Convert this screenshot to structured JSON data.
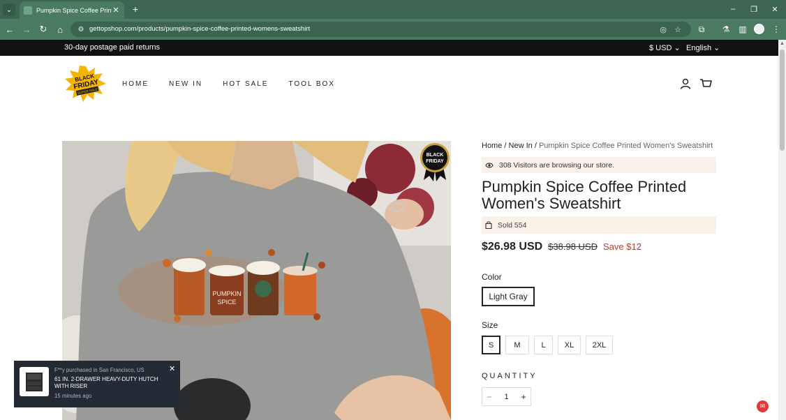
{
  "browser": {
    "tab_title": "Pumpkin Spice Coffee Printed Women",
    "url": "gettopshop.com/products/pumpkin-spice-coffee-printed-womens-sweatshirt"
  },
  "announcement": {
    "text": "30-day postage paid returns",
    "currency": "$ USD",
    "language": "English"
  },
  "header": {
    "logo_text": [
      "BLACK",
      "FRIDAY",
      "SUPER SALE"
    ],
    "nav": [
      "HOME",
      "NEW IN",
      "HOT SALE",
      "TOOL BOX"
    ]
  },
  "badge": {
    "lines": [
      "BLACK",
      "FRIDAY"
    ]
  },
  "breadcrumb": {
    "home": "Home",
    "sep1": " / ",
    "section": "New In",
    "sep2": " / ",
    "current": "Pumpkin Spice Coffee Printed Women's Sweatshirt"
  },
  "product": {
    "visitors": "308 Visitors are browsing our store.",
    "title": "Pumpkin Spice Coffee Printed Women's Sweatshirt",
    "sold": "Sold 554",
    "price": "$26.98 USD",
    "compare_price": "$38.98 USD",
    "save": "Save $12",
    "color_label": "Color",
    "color_selected": "Light Gray",
    "size_label": "Size",
    "sizes": [
      "S",
      "M",
      "L",
      "XL",
      "2XL"
    ],
    "size_selected": "S",
    "quantity_label": "QUANTITY",
    "quantity": "1",
    "minus": "−",
    "plus": "+"
  },
  "print": {
    "mug_text": [
      "PUMPKIN",
      "SPICE"
    ]
  },
  "toast": {
    "line1": "F**y purchased in San Francisco, US",
    "line2": "61 IN. 2-DRAWER HEAVY-DUTY HUTCH WITH RISER",
    "line3": "15 minutes ago"
  },
  "colors": {
    "announcement_bg": "#111111",
    "info_box_bg": "#faf1e8",
    "save_color": "#c0392b",
    "browser_frame": "#4b7a62"
  }
}
